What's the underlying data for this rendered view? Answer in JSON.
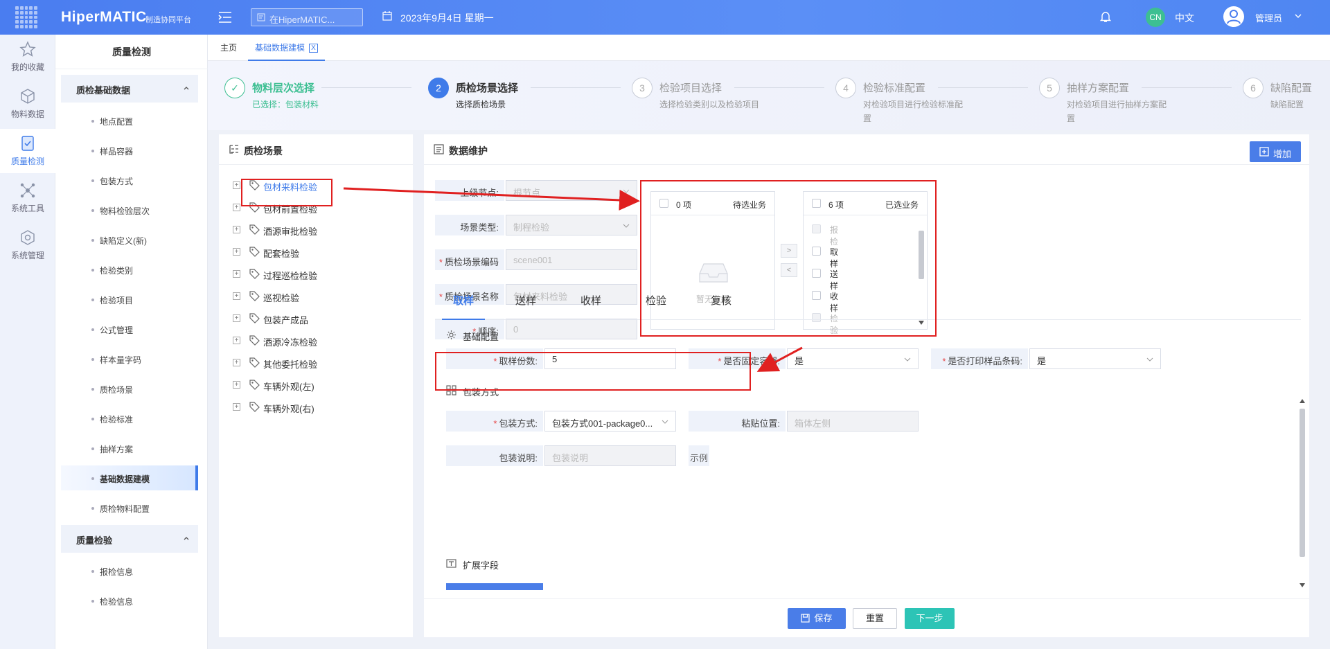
{
  "app": {
    "brand": "HiperMATIC",
    "brand_sub": "制造协同平台",
    "search_placeholder": "在HiperMATIC...",
    "date": "2023年9月4日 星期一",
    "lang_badge": "CN",
    "lang_label": "中文",
    "user": "管理员",
    "accent": "#3f7be9",
    "success": "#3dbf92"
  },
  "rail": [
    {
      "label": "我的收藏",
      "icon": "star-icon"
    },
    {
      "label": "物料数据",
      "icon": "cube-icon"
    },
    {
      "label": "质量检测",
      "icon": "shield-check-icon",
      "active": true
    },
    {
      "label": "系统工具",
      "icon": "network-icon"
    },
    {
      "label": "系统管理",
      "icon": "gear-box-icon"
    }
  ],
  "subnav": {
    "title": "质量检测",
    "groups": [
      {
        "label": "质检基础数据",
        "items": [
          "地点配置",
          "样品容器",
          "包装方式",
          "物料检验层次",
          "缺陷定义(新)",
          "检验类别",
          "检验项目",
          "公式管理",
          "样本量字码",
          "质检场景",
          "检验标准",
          "抽样方案",
          "基础数据建模",
          "质检物料配置"
        ]
      },
      {
        "label": "质量检验",
        "items": [
          "报检信息",
          "检验信息"
        ]
      }
    ]
  },
  "page_tabs": [
    {
      "label": "主页"
    },
    {
      "label": "基础数据建模",
      "close": "X",
      "active": true
    }
  ],
  "steps": [
    {
      "num": "✓",
      "title": "物料层次选择",
      "desc": "已选择：包装材料",
      "state": "done"
    },
    {
      "num": "2",
      "title": "质检场景选择",
      "desc": "选择质检场景",
      "state": "active"
    },
    {
      "num": "3",
      "title": "检验项目选择",
      "desc": "选择检验类别以及检验项目",
      "state": "todo"
    },
    {
      "num": "4",
      "title": "检验标准配置",
      "desc": "对检验项目进行检验标准配置",
      "state": "todo"
    },
    {
      "num": "5",
      "title": "抽样方案配置",
      "desc": "对检验项目进行抽样方案配置",
      "state": "todo"
    },
    {
      "num": "6",
      "title": "缺陷配置",
      "desc": "缺陷配置",
      "state": "todo"
    }
  ],
  "scene_panel": {
    "title": "质检场景",
    "items": [
      "包材来料检验",
      "包材前置检验",
      "酒源审批检验",
      "配套检验",
      "过程巡检检验",
      "巡视检验",
      "包装产成品",
      "酒源冷冻检验",
      "其他委托检验",
      "车辆外观(左)",
      "车辆外观(右)"
    ]
  },
  "data_panel": {
    "title": "数据维护",
    "add_label": "增加",
    "form": {
      "parent_label": "上级节点",
      "parent_value": "根节点",
      "type_label": "场景类型",
      "type_value": "制程检验",
      "code_label": "质检场景编码",
      "code_value": "scene001",
      "name_label": "质检场景名称",
      "name_value": "包材来料检验",
      "order_label": "顺序",
      "order_value": "0"
    },
    "transfer": {
      "left_count": "0 项",
      "left_title": "待选业务",
      "empty_text": "暂无数据",
      "right_count": "6 项",
      "right_title": "已选业务",
      "right_items": [
        {
          "label": "报检",
          "disabled": true
        },
        {
          "label": "取样",
          "disabled": false
        },
        {
          "label": "送样",
          "disabled": false
        },
        {
          "label": "收样",
          "disabled": false
        },
        {
          "label": "检验",
          "disabled": true
        }
      ],
      "to_right": ">",
      "to_left": "<"
    },
    "biz_tabs": [
      "取样",
      "送样",
      "收样",
      "检验",
      "复核"
    ],
    "basic": {
      "title": "基础配置",
      "sample_count_label": "取样份数:",
      "sample_count_value": "5",
      "fixed_container_label": "是否固定容器:",
      "fixed_container_value": "是",
      "print_barcode_label": "是否打印样品条码:",
      "print_barcode_value": "是"
    },
    "packaging": {
      "title": "包装方式",
      "method_label": "包装方式:",
      "method_value": "包装方式001-package0...",
      "paste_label": "粘贴位置:",
      "paste_placeholder": "箱体左侧",
      "desc_label": "包装说明:",
      "desc_placeholder": "包装说明",
      "example": "示例"
    },
    "extension": {
      "title": "扩展字段"
    }
  },
  "footer": {
    "save": "保存",
    "reset": "重置",
    "next": "下一步"
  }
}
